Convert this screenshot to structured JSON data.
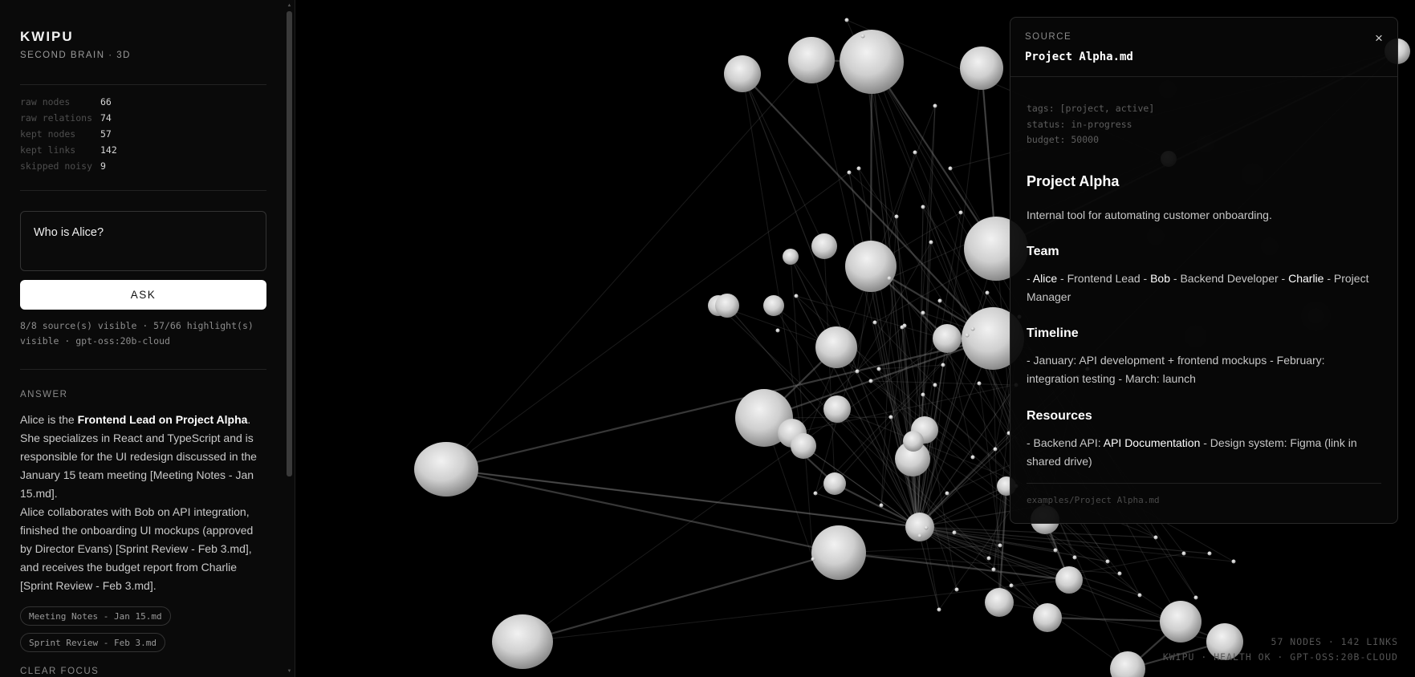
{
  "app": {
    "title": "KWIPU",
    "subtitle": "SECOND BRAIN · 3D"
  },
  "stats": [
    {
      "key": "raw nodes",
      "value": "66"
    },
    {
      "key": "raw relations",
      "value": "74"
    },
    {
      "key": "kept nodes",
      "value": "57"
    },
    {
      "key": "kept links",
      "value": "142"
    },
    {
      "key": "skipped noisy",
      "value": "9"
    }
  ],
  "query": {
    "text": "Who is Alice?"
  },
  "ask_label": "ASK",
  "meta": {
    "line1": "8/8 source(s) visible · 57/66 highlight(s)",
    "line2": "visible · gpt-oss:20b-cloud"
  },
  "answer": {
    "label": "ANSWER",
    "p1_before": "Alice is the ",
    "p1_bold": "Frontend Lead on Project Alpha",
    "p1_after": ". She specializes in React and TypeScript and is responsible for the UI redesign discussed in the January 15 team meeting [Meeting Notes - Jan 15.md].",
    "p2": "Alice collaborates with Bob on API integration, finished the onboarding UI mockups (approved by Director Evans) [Sprint Review - Feb 3.md], and receives the budget report from Charlie [Sprint Review - Feb 3.md]."
  },
  "sources": [
    "Meeting Notes - Jan 15.md",
    "Sprint Review - Feb 3.md"
  ],
  "clear_focus_label": "CLEAR FOCUS",
  "panel": {
    "label": "SOURCE",
    "filename": "Project Alpha.md",
    "close_glyph": "×",
    "frontmatter": [
      "tags: [project, active]",
      "status: in-progress",
      "budget: 50000"
    ],
    "title": "Project Alpha",
    "intro": "Internal tool for automating customer onboarding.",
    "team": {
      "heading": "Team",
      "t0": "- ",
      "name1": "Alice",
      "t1": " - Frontend Lead - ",
      "name2": "Bob",
      "t2": " - Backend Developer - ",
      "name3": "Charlie",
      "t3": " - Project Manager"
    },
    "timeline": {
      "heading": "Timeline",
      "text": "- January: API development + frontend mockups - February: integration testing - March: launch"
    },
    "resources": {
      "heading": "Resources",
      "before": "- Backend API: ",
      "link": "API Documentation",
      "after": " - Design system: Figma (link in shared drive)"
    },
    "path": "examples/Project Alpha.md"
  },
  "status": {
    "line1": "57 NODES · 142 LINKS",
    "line2": "KWIPU · HEALTH OK · GPT-OSS:20B-CLOUD"
  },
  "colors": {
    "background": "#000000",
    "accent": "#ffffff",
    "node": "#d9d9d9"
  }
}
